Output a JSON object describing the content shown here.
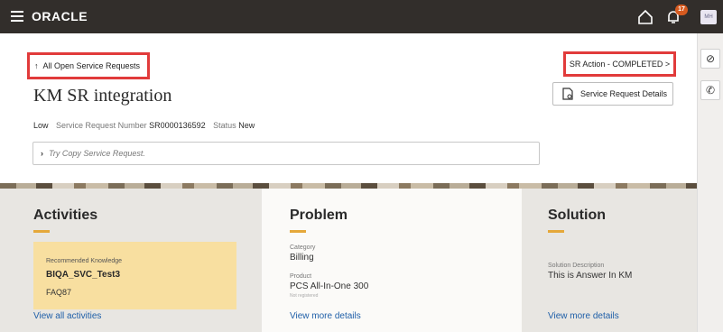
{
  "app": {
    "brand": "ORACLE",
    "notification_count": "17",
    "user_initials": "MH"
  },
  "header": {
    "back_link": "All Open Service Requests",
    "sr_action": "SR Action - COMPLETED >",
    "details_button": "Service Request Details",
    "title": "KM SR integration",
    "severity": "Low",
    "number_label": "Service Request Number",
    "number_value": "SR0000136592",
    "status_label": "Status",
    "status_value": "New",
    "copy_placeholder": "Try Copy Service Request."
  },
  "activities": {
    "title": "Activities",
    "card_caption": "Recommended Knowledge",
    "card_name": "BIQA_SVC_Test3",
    "card_id": "FAQ87",
    "link": "View all activities"
  },
  "problem": {
    "title": "Problem",
    "category_label": "Category",
    "category_value": "Billing",
    "product_label": "Product",
    "product_value": "PCS All-In-One 300",
    "product_sub": "Not registered",
    "link": "View more details"
  },
  "solution": {
    "title": "Solution",
    "desc_label": "Solution Description",
    "desc_value": "This is Answer In KM",
    "link": "View more details"
  },
  "colors": {
    "topbar": "#322e2b",
    "highlight_box": "#e13b3b",
    "accent_underline": "#e5a83a",
    "card": "#f8dfa0",
    "link": "#1f5fa8"
  }
}
